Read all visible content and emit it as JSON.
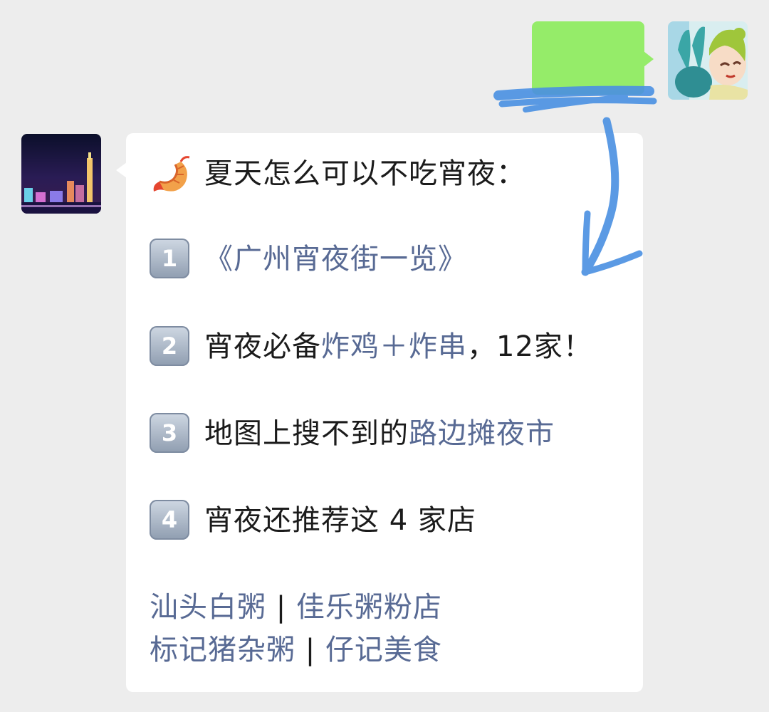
{
  "chat": {
    "intro": "夏天怎么可以不吃宵夜：",
    "items": [
      {
        "badge": "1",
        "link": "《广州宵夜街一览》"
      },
      {
        "badge": "2",
        "prefix": "宵夜必备",
        "link": "炸鸡＋炸串",
        "suffix": "，12家！"
      },
      {
        "badge": "3",
        "prefix": "地图上搜不到的",
        "link": "路边摊夜市"
      },
      {
        "badge": "4",
        "prefix": "宵夜还推荐这 4 家店"
      }
    ],
    "shops": [
      {
        "a": "汕头白粥",
        "sep": "|",
        "b": "佳乐粥粉店"
      },
      {
        "a": "标记猪杂粥",
        "sep": "|",
        "b": "仔记美食"
      }
    ]
  },
  "colors": {
    "background": "#ededed",
    "sent_bubble": "#95ec69",
    "received_bubble": "#ffffff",
    "link_text": "#586a94",
    "annotation_stroke": "#4a90e2"
  },
  "icons": {
    "intro_icon": "shrimp-icon",
    "annotation": "hand-drawn-arrow-icon"
  }
}
